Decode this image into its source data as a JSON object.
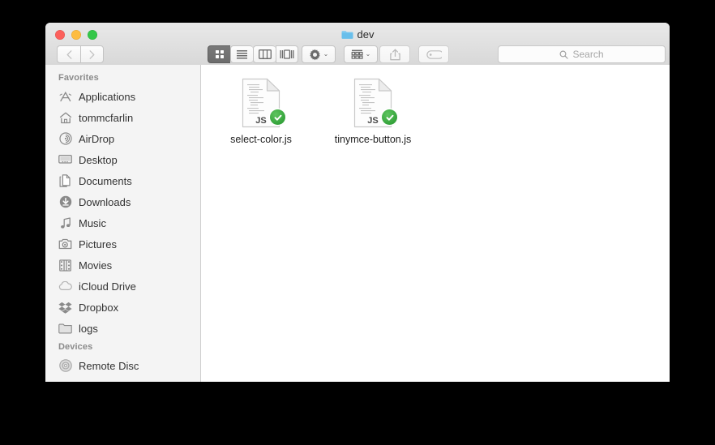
{
  "window": {
    "title": "dev",
    "title_icon": "folder-icon",
    "traffic_lights": [
      {
        "name": "close-button",
        "color": "#fc605c"
      },
      {
        "name": "minimize-button",
        "color": "#fdbc40"
      },
      {
        "name": "zoom-button",
        "color": "#34c749"
      }
    ]
  },
  "toolbar": {
    "back_icon": "chevron-left-icon",
    "forward_icon": "chevron-right-icon",
    "view_modes": [
      {
        "name": "icon-view",
        "icon": "grid-icon",
        "active": true
      },
      {
        "name": "list-view",
        "icon": "list-icon",
        "active": false
      },
      {
        "name": "column-view",
        "icon": "columns-icon",
        "active": false
      },
      {
        "name": "gallery-view",
        "icon": "gallery-icon",
        "active": false
      }
    ],
    "action_button": {
      "name": "action-menu",
      "icon": "gear-icon",
      "chevron": "⌄"
    },
    "arrange_button": {
      "name": "arrange-menu",
      "icon": "arrange-grid-icon",
      "chevron": "⌄"
    },
    "share_button": {
      "name": "share-button",
      "icon": "share-icon"
    },
    "tag_button": {
      "name": "tag-button",
      "icon": "tag-icon"
    }
  },
  "search": {
    "icon": "search-icon",
    "placeholder": "Search",
    "value": ""
  },
  "sidebar": {
    "sections": [
      {
        "label": "Favorites",
        "items": [
          {
            "label": "Applications",
            "icon": "applications-icon"
          },
          {
            "label": "tommcfarlin",
            "icon": "home-icon"
          },
          {
            "label": "AirDrop",
            "icon": "airdrop-icon"
          },
          {
            "label": "Desktop",
            "icon": "desktop-icon"
          },
          {
            "label": "Documents",
            "icon": "documents-icon"
          },
          {
            "label": "Downloads",
            "icon": "downloads-icon"
          },
          {
            "label": "Music",
            "icon": "music-icon"
          },
          {
            "label": "Pictures",
            "icon": "pictures-icon"
          },
          {
            "label": "Movies",
            "icon": "movies-icon"
          },
          {
            "label": "iCloud Drive",
            "icon": "icloud-icon"
          },
          {
            "label": "Dropbox",
            "icon": "dropbox-icon"
          },
          {
            "label": "logs",
            "icon": "folder-icon"
          }
        ]
      },
      {
        "label": "Devices",
        "items": [
          {
            "label": "Remote Disc",
            "icon": "disc-icon"
          }
        ]
      }
    ]
  },
  "files": [
    {
      "name": "select-color.js",
      "type_label": "JS",
      "status_badge": "check-badge"
    },
    {
      "name": "tinymce-button.js",
      "type_label": "JS",
      "status_badge": "check-badge"
    }
  ],
  "colors": {
    "badge_green": "#33a23a",
    "folder_blue": "#6fc4ef",
    "active_view": "#6c6c6c"
  }
}
